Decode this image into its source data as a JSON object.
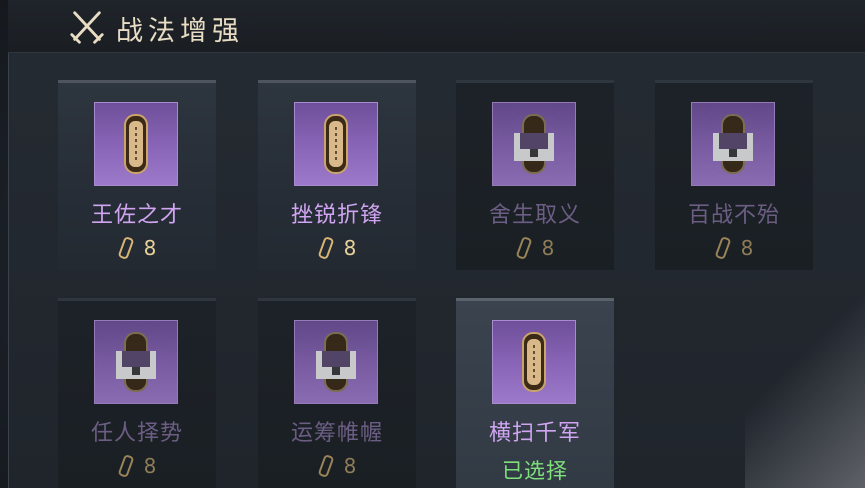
{
  "header": {
    "title": "战法增强",
    "icon": "crossed-swords-icon"
  },
  "cards": [
    {
      "name": "王佐之才",
      "token_text": "王佐之才",
      "cost": "8",
      "state": "unlocked",
      "status": ""
    },
    {
      "name": "挫锐折锋",
      "token_text": "挫锐折锋",
      "cost": "8",
      "state": "unlocked",
      "status": ""
    },
    {
      "name": "舍生取义",
      "token_text": "",
      "cost": "8",
      "state": "locked",
      "status": ""
    },
    {
      "name": "百战不殆",
      "token_text": "",
      "cost": "8",
      "state": "locked",
      "status": ""
    },
    {
      "name": "任人择势",
      "token_text": "",
      "cost": "8",
      "state": "locked",
      "status": ""
    },
    {
      "name": "运筹帷幄",
      "token_text": "",
      "cost": "8",
      "state": "locked",
      "status": ""
    },
    {
      "name": "横扫千军",
      "token_text": "横扫千军",
      "cost": "",
      "state": "selected",
      "status": "已选择"
    }
  ],
  "colors": {
    "name_active": "#cfa4f0",
    "name_locked": "#6c5d84",
    "cost_gold": "#e9d39b",
    "selected_green": "#7fe07c",
    "tile_purple": "#8a66b8"
  }
}
